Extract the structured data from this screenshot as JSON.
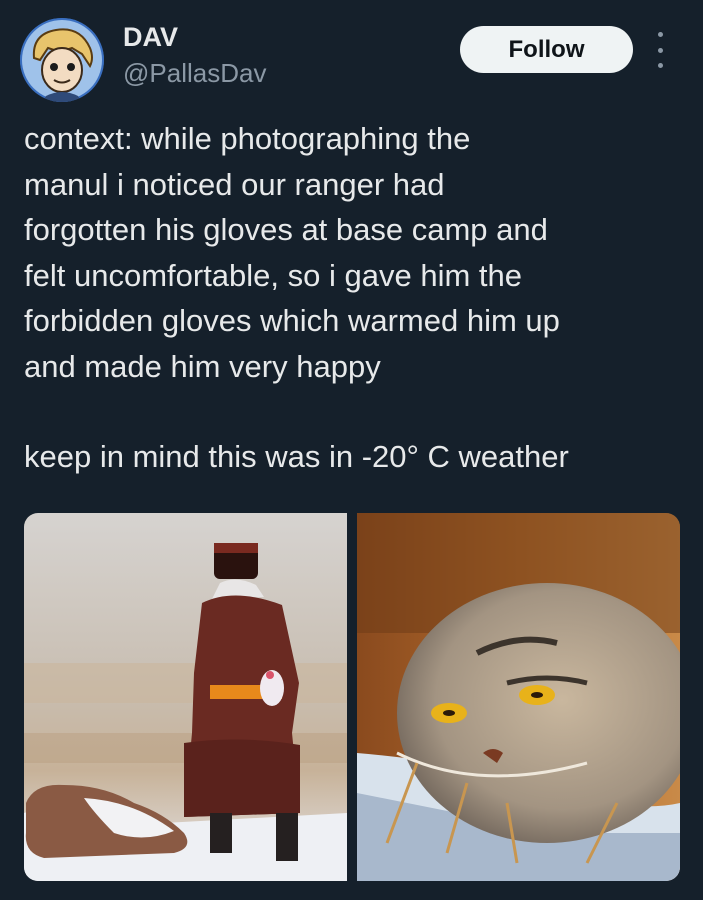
{
  "author": {
    "display_name": "DAV",
    "handle": "@PallasDav",
    "avatar_icon": "cartoon-avatar-icon"
  },
  "actions": {
    "follow_label": "Follow",
    "more_icon": "more-vertical-icon"
  },
  "tweet": {
    "text_paragraph_1": "context: while photographing the\nmanul i noticed our ranger had\nforgotten his gloves at base camp and\nfelt uncomfortable, so i gave him the\nforbidden gloves which warmed him up\nand made him very happy",
    "text_paragraph_2": "keep in mind this was in -20° C weather"
  },
  "media": {
    "images": [
      {
        "icon": "photo-ranger-icon"
      },
      {
        "icon": "photo-manul-icon"
      }
    ]
  },
  "colors": {
    "background": "#15202b",
    "text_primary": "#e7e9ea",
    "text_secondary": "#8b98a5",
    "button_bg": "#eff3f4"
  }
}
